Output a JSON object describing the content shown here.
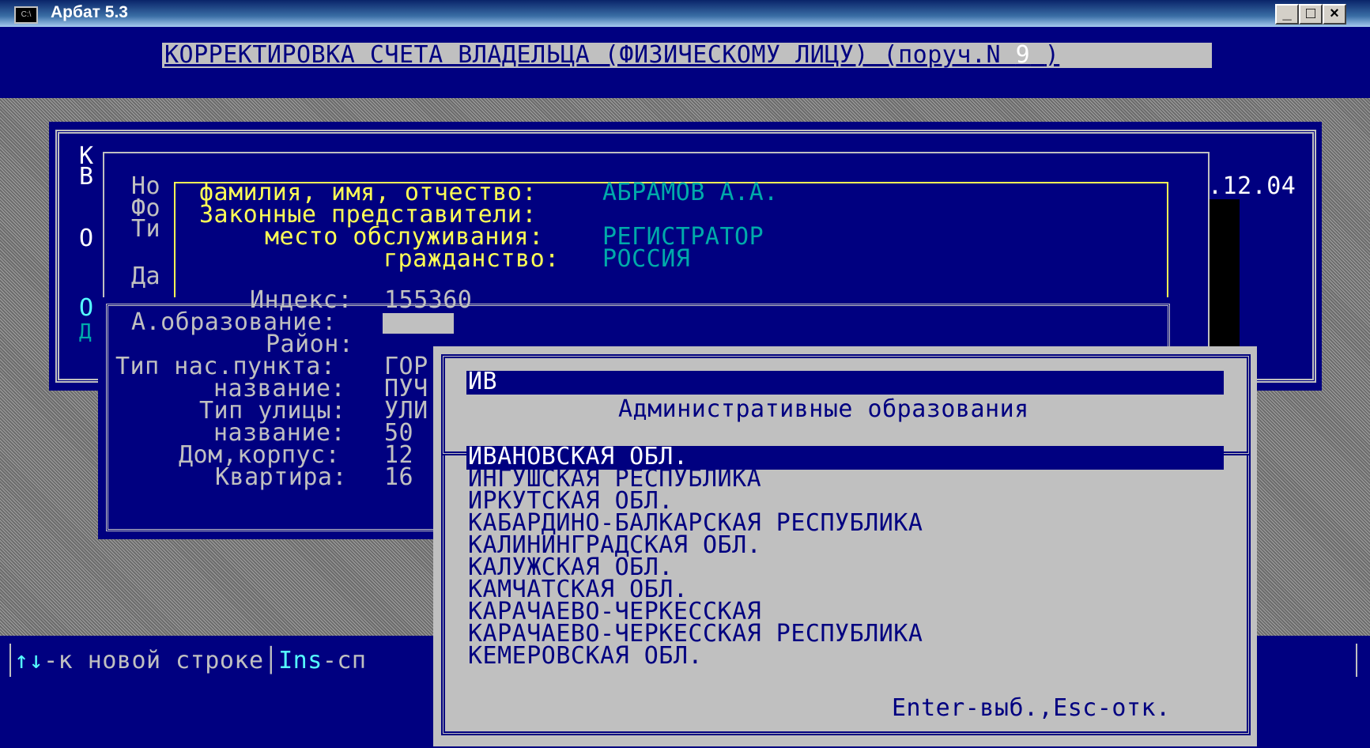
{
  "window": {
    "title": "Арбат 5.3",
    "sys_icon": "C:\\",
    "buttons": {
      "minimize": "_",
      "maximize": "□",
      "close": "×"
    }
  },
  "header": {
    "text": "КОРРЕКТИРОВКА СЧЕТА ВЛАДЕЛЬЦА (ФИЗИЧЕСКОМУ ЛИЦУ) (поруч.N",
    "order_number": "9",
    "close_paren": ")"
  },
  "back_panel": {
    "letters": [
      "К",
      "В",
      "О",
      "О",
      "Д"
    ],
    "date_fragment": ".12.04",
    "labels": [
      "Но",
      "Фо",
      "Ти",
      "Да"
    ]
  },
  "owner_info": {
    "fio_label": "фамилия, имя, отчество:",
    "fio_value": "АБРАМОВ А.А.",
    "reps_label": "Законные представители:",
    "service_label": "место обслуживания:",
    "service_value": "РЕГИСТРАТОР",
    "citizenship_label": "гражданство:",
    "citizenship_value": "РОССИЯ"
  },
  "address": {
    "index_label": "Индекс:",
    "index_value": "155360",
    "admin_label": "А.образование:",
    "admin_value": "",
    "district_label": "Район:",
    "settlement_type_label": "Тип нас.пункта:",
    "settlement_type_value": "ГОР",
    "settlement_name_label": "название:",
    "settlement_name_value": "ПУЧ",
    "street_type_label": "Тип улицы:",
    "street_type_value": "УЛИ",
    "street_name_label": "название:",
    "street_name_value": "50",
    "house_label": "Дом,корпус:",
    "house_value": "12",
    "apartment_label": "Квартира:",
    "apartment_value": "16"
  },
  "status_bar": {
    "arrows": "↑↓",
    "hint1": "-к новой строке",
    "key2": "Ins",
    "hint2": "-сп"
  },
  "lookup": {
    "search_value": "ИВ",
    "title": "Административные образования",
    "items": [
      "ИВАНОВСКАЯ ОБЛ.",
      "ИНГУШСКАЯ РЕСПУБЛИКА",
      "ИРКУТСКАЯ ОБЛ.",
      "КАБАРДИНО-БАЛКАРСКАЯ РЕСПУБЛИКА",
      "КАЛИНИНГРАДСКАЯ ОБЛ.",
      "КАЛУЖСКАЯ ОБЛ.",
      "КАМЧАТСКАЯ ОБЛ.",
      "КАРАЧАЕВО-ЧЕРКЕССКАЯ",
      "КАРАЧАЕВО-ЧЕРКЕССКАЯ РЕСПУБЛИКА",
      "КЕМЕРОВСКАЯ ОБЛ."
    ],
    "selected_index": 0,
    "footer": "Enter-выб.,Esc-отк."
  },
  "colors": {
    "console_bg": "#000080",
    "label_yellow": "#ffff55",
    "value_teal": "#00aaaa",
    "popup_bg": "#c0c0c0"
  }
}
